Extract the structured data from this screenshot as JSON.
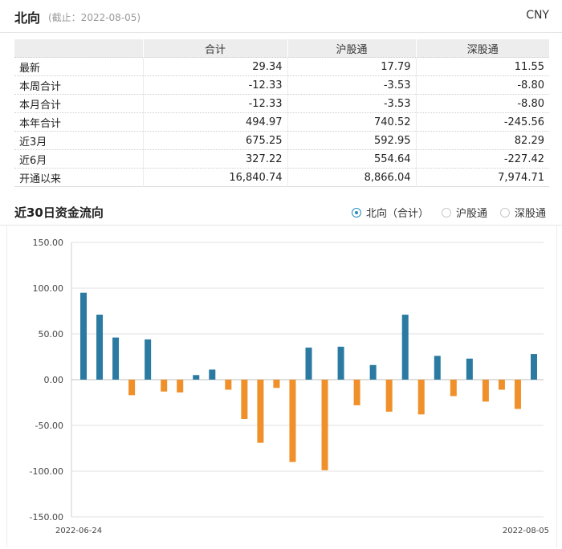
{
  "header": {
    "title": "北向",
    "cutoff": "(截止：2022-08-05)",
    "currency": "CNY"
  },
  "table": {
    "columns": [
      "",
      "合计",
      "沪股通",
      "深股通"
    ],
    "rows": [
      {
        "label": "最新",
        "total": "29.34",
        "sh": "17.79",
        "sz": "11.55"
      },
      {
        "label": "本周合计",
        "total": "-12.33",
        "sh": "-3.53",
        "sz": "-8.80"
      },
      {
        "label": "本月合计",
        "total": "-12.33",
        "sh": "-3.53",
        "sz": "-8.80"
      },
      {
        "label": "本年合计",
        "total": "494.97",
        "sh": "740.52",
        "sz": "-245.56"
      },
      {
        "label": "近3月",
        "total": "675.25",
        "sh": "592.95",
        "sz": "82.29"
      },
      {
        "label": "近6月",
        "total": "327.22",
        "sh": "554.64",
        "sz": "-227.42"
      },
      {
        "label": "开通以来",
        "total": "16,840.74",
        "sh": "8,866.04",
        "sz": "7,974.71"
      }
    ]
  },
  "section": {
    "title": "近30日资金流向",
    "options": [
      {
        "label": "北向（合计）",
        "selected": true
      },
      {
        "label": "沪股通",
        "selected": false
      },
      {
        "label": "深股通",
        "selected": false
      }
    ]
  },
  "colors": {
    "positive": "#2a7aa1",
    "negative": "#f0902a",
    "accent": "#2b8cbf"
  },
  "chart_data": {
    "type": "bar",
    "title": "",
    "ylim": [
      -150,
      150
    ],
    "yticks": [
      150,
      100,
      50,
      0,
      -50,
      -100,
      -150
    ],
    "ytick_labels": [
      "150.00",
      "100.00",
      "50.00",
      "0.00",
      "-50.00",
      "-100.00",
      "-150.00"
    ],
    "x_start_label": "2022-06-24",
    "x_end_label": "2022-08-05",
    "values": [
      95,
      71,
      46,
      -17,
      44,
      -13,
      -14,
      5,
      11,
      -11,
      -43,
      -69,
      -9,
      -90,
      35,
      -99,
      36,
      -28,
      16,
      -35,
      71,
      -38,
      26,
      -18,
      23,
      -24,
      -11,
      -32,
      28
    ]
  }
}
